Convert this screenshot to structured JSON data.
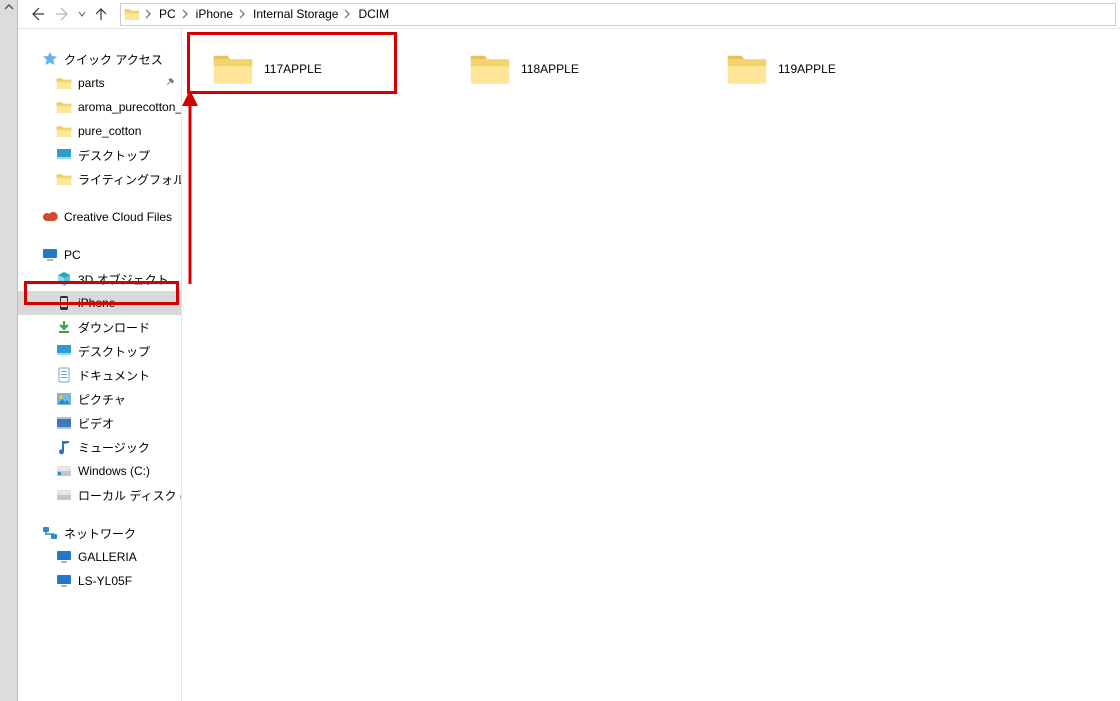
{
  "breadcrumbs": {
    "items": [
      {
        "label": "PC"
      },
      {
        "label": "iPhone"
      },
      {
        "label": "Internal Storage"
      },
      {
        "label": "DCIM"
      }
    ]
  },
  "sidebar": {
    "quick_access": {
      "label": "クイック アクセス",
      "items": [
        {
          "label": "parts",
          "pinned": true
        },
        {
          "label": "aroma_purecotton_"
        },
        {
          "label": "pure_cotton"
        },
        {
          "label": "デスクトップ",
          "type": "desktop"
        },
        {
          "label": "ライティングフォルダ"
        }
      ]
    },
    "creative_cloud": {
      "label": "Creative Cloud Files"
    },
    "pc": {
      "label": "PC",
      "items": [
        {
          "label": "3D オブジェクト",
          "type": "3d"
        },
        {
          "label": "iPhone",
          "type": "phone",
          "selected": true
        },
        {
          "label": "ダウンロード",
          "type": "download"
        },
        {
          "label": "デスクトップ",
          "type": "desktop"
        },
        {
          "label": "ドキュメント",
          "type": "documents"
        },
        {
          "label": "ピクチャ",
          "type": "pictures"
        },
        {
          "label": "ビデオ",
          "type": "videos"
        },
        {
          "label": "ミュージック",
          "type": "music"
        },
        {
          "label": "Windows (C:)",
          "type": "drive"
        },
        {
          "label": "ローカル ディスク (D:)",
          "type": "drive"
        }
      ]
    },
    "network": {
      "label": "ネットワーク",
      "items": [
        {
          "label": "GALLERIA",
          "type": "computer"
        },
        {
          "label": "LS-YL05F",
          "type": "computer"
        }
      ]
    }
  },
  "content": {
    "folders": [
      {
        "label": "117APPLE"
      },
      {
        "label": "118APPLE"
      },
      {
        "label": "119APPLE"
      }
    ]
  }
}
